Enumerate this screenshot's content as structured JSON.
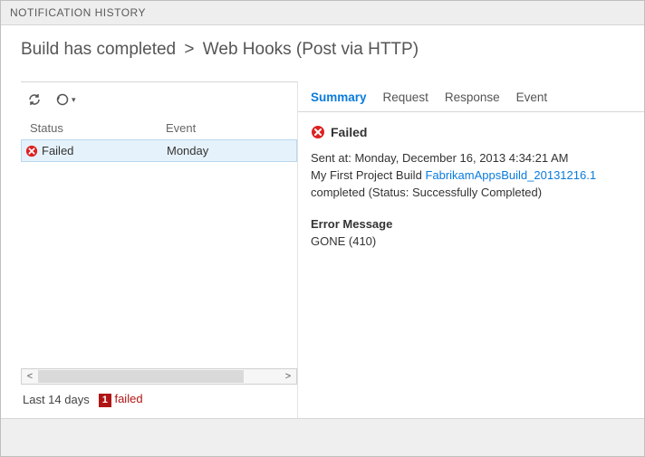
{
  "window": {
    "title": "NOTIFICATION HISTORY"
  },
  "header": {
    "crumb1": "Build has completed",
    "crumb2": "Web Hooks (Post via HTTP)"
  },
  "list": {
    "columns": {
      "status": "Status",
      "event": "Event"
    },
    "rows": [
      {
        "status": "Failed",
        "event": "Monday"
      }
    ],
    "range_label": "Last 14 days",
    "failed_count": "1",
    "failed_label": "failed"
  },
  "tabs": {
    "summary": "Summary",
    "request": "Request",
    "response": "Response",
    "event": "Event"
  },
  "detail": {
    "status": "Failed",
    "sent_label": "Sent at:",
    "sent_value": "Monday, December 16, 2013 4:34:21 AM",
    "line_prefix": "My First Project Build",
    "build_link": "FabrikamAppsBuild_20131216.1",
    "line_suffix": "completed (Status: Successfully Completed)",
    "error_label": "Error Message",
    "error_value": "GONE (410)"
  },
  "colors": {
    "accent": "#0a7bdc",
    "error": "#b01515",
    "selection": "#e6f2fb"
  }
}
